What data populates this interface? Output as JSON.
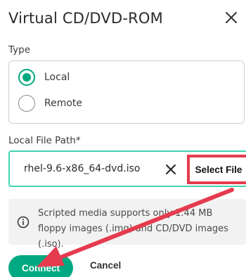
{
  "dialog": {
    "title": "Virtual CD/DVD-ROM",
    "close_icon": "close-icon"
  },
  "type_section": {
    "label": "Type",
    "options": [
      {
        "label": "Local",
        "checked": true
      },
      {
        "label": "Remote",
        "checked": false
      }
    ]
  },
  "file_path": {
    "label": "Local File Path*",
    "value": "rhel-9.6-x86_64-dvd.iso",
    "clear_icon": "close-icon",
    "select_button": "Select File"
  },
  "info": {
    "icon": "info-circle-icon",
    "text": "Scripted media supports only 1.44 MB floppy images (.img) and CD/DVD images (.iso)."
  },
  "footer": {
    "connect": "Connect",
    "cancel": "Cancel"
  },
  "colors": {
    "accent": "#01a982",
    "focus_border": "#3fd3b0",
    "annotation_red": "#e53b4e"
  }
}
